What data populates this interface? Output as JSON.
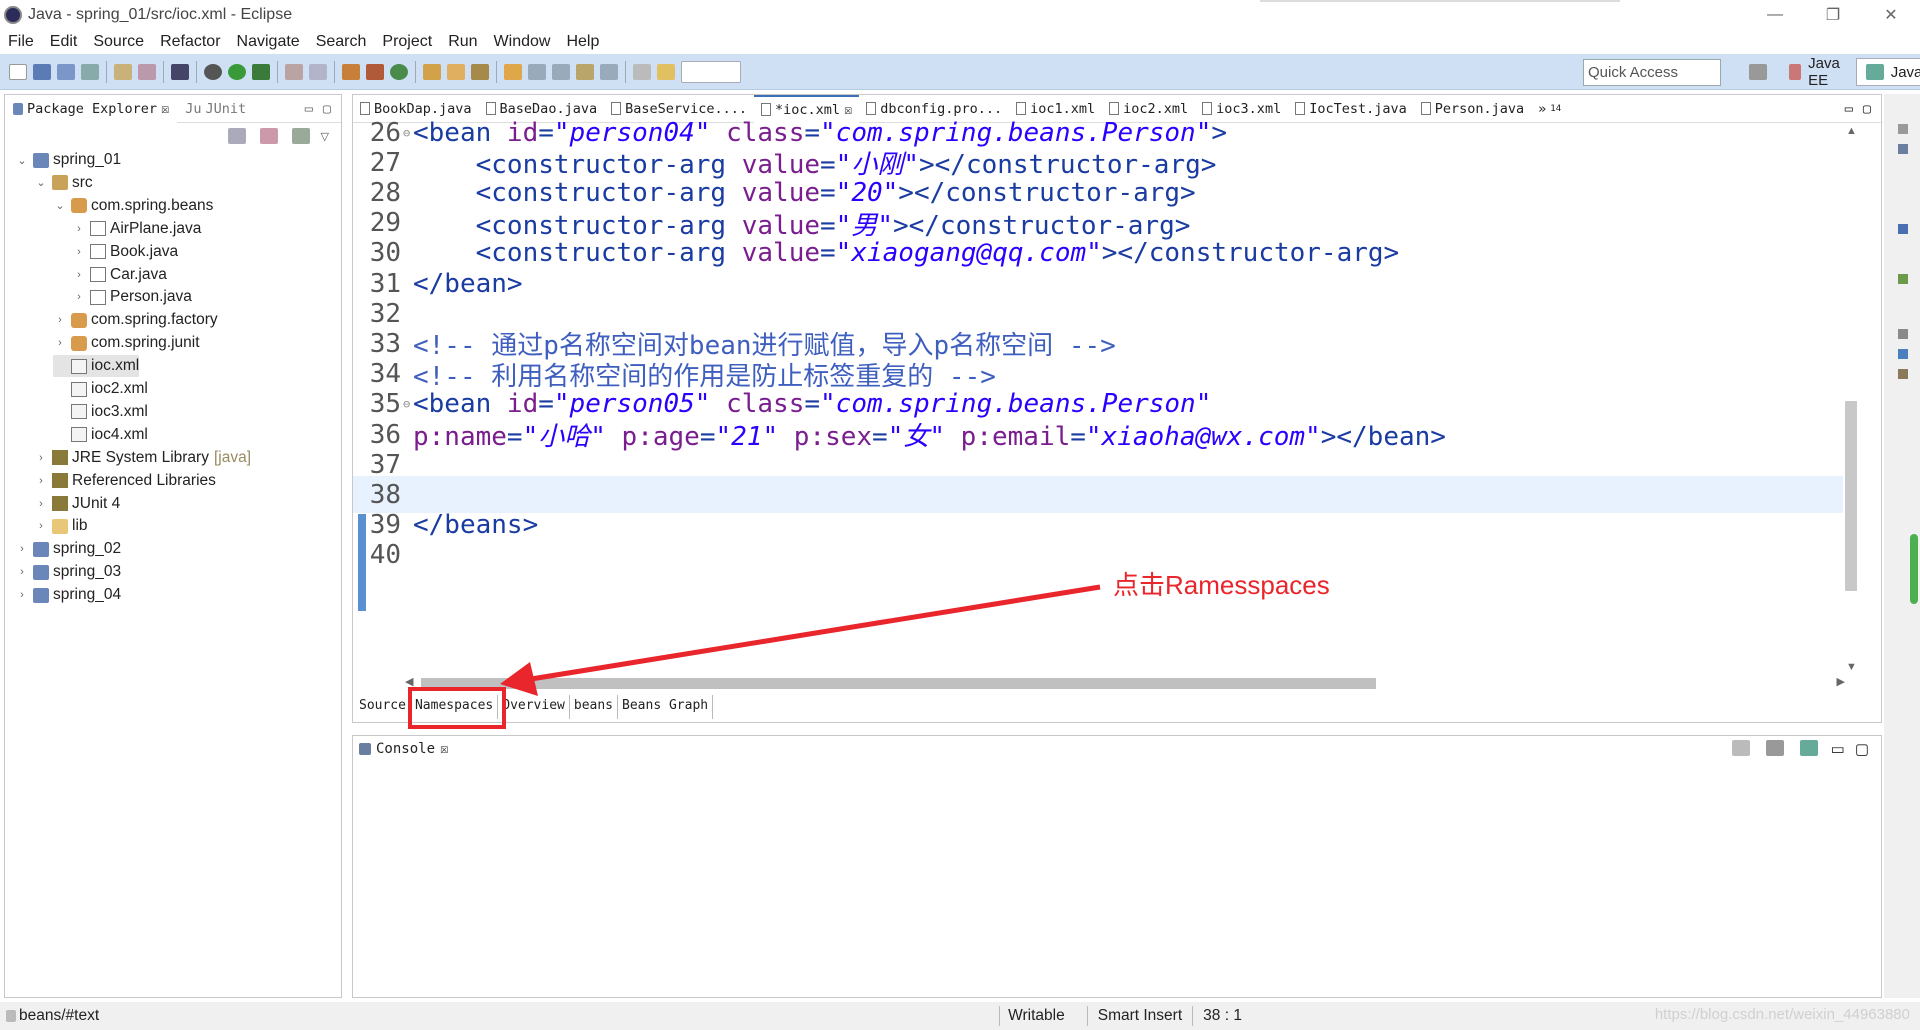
{
  "window": {
    "title": "Java - spring_01/src/ioc.xml - Eclipse"
  },
  "menu": [
    "File",
    "Edit",
    "Source",
    "Refactor",
    "Navigate",
    "Search",
    "Project",
    "Run",
    "Window",
    "Help"
  ],
  "toolbar": {
    "quick_access_placeholder": "Quick Access"
  },
  "perspectives": [
    "Java EE",
    "Java"
  ],
  "package_explorer": {
    "tabs": [
      "Package Explorer",
      "JUnit"
    ],
    "tree": [
      {
        "label": "spring_01",
        "depth": 0,
        "icon": "project",
        "expanded": true
      },
      {
        "label": "src",
        "depth": 1,
        "icon": "source-folder",
        "expanded": true
      },
      {
        "label": "com.spring.beans",
        "depth": 2,
        "icon": "package",
        "expanded": true
      },
      {
        "label": "AirPlane.java",
        "depth": 3,
        "icon": "java-file"
      },
      {
        "label": "Book.java",
        "depth": 3,
        "icon": "java-file"
      },
      {
        "label": "Car.java",
        "depth": 3,
        "icon": "java-file"
      },
      {
        "label": "Person.java",
        "depth": 3,
        "icon": "java-file"
      },
      {
        "label": "com.spring.factory",
        "depth": 2,
        "icon": "package"
      },
      {
        "label": "com.spring.junit",
        "depth": 2,
        "icon": "package"
      },
      {
        "label": "ioc.xml",
        "depth": 2,
        "icon": "xml-file",
        "selected": true
      },
      {
        "label": "ioc2.xml",
        "depth": 2,
        "icon": "xml-file"
      },
      {
        "label": "ioc3.xml",
        "depth": 2,
        "icon": "xml-file"
      },
      {
        "label": "ioc4.xml",
        "depth": 2,
        "icon": "xml-file"
      },
      {
        "label": "JRE System Library",
        "suffix": "[java]",
        "depth": 1,
        "icon": "library"
      },
      {
        "label": "Referenced Libraries",
        "depth": 1,
        "icon": "library"
      },
      {
        "label": "JUnit 4",
        "depth": 1,
        "icon": "library"
      },
      {
        "label": "lib",
        "depth": 1,
        "icon": "folder"
      },
      {
        "label": "spring_02",
        "depth": 0,
        "icon": "project"
      },
      {
        "label": "spring_03",
        "depth": 0,
        "icon": "project"
      },
      {
        "label": "spring_04",
        "depth": 0,
        "icon": "project"
      }
    ]
  },
  "editor": {
    "tabs": [
      "BookDap.java",
      "BaseDao.java",
      "BaseService....",
      "*ioc.xml",
      "dbconfig.pro...",
      "ioc1.xml",
      "ioc2.xml",
      "ioc3.xml",
      "IocTest.java",
      "Person.java"
    ],
    "overflow_count": "14",
    "active_tab": "*ioc.xml",
    "lines": [
      {
        "n": "26",
        "fold": "⊖",
        "parts": [
          [
            "tag",
            "<bean "
          ],
          [
            "attr",
            "id"
          ],
          [
            "tag",
            "="
          ],
          [
            "val",
            "\"person04\""
          ],
          [
            "tag",
            " "
          ],
          [
            "attr",
            "class"
          ],
          [
            "tag",
            "="
          ],
          [
            "val",
            "\"com.spring.beans.Person\""
          ],
          [
            "tag",
            ">"
          ]
        ]
      },
      {
        "n": "27",
        "parts": [
          [
            "tag",
            "    <constructor-arg "
          ],
          [
            "attr",
            "value"
          ],
          [
            "tag",
            "="
          ],
          [
            "val",
            "\"小刚\""
          ],
          [
            "tag",
            "></constructor-arg>"
          ]
        ]
      },
      {
        "n": "28",
        "parts": [
          [
            "tag",
            "    <constructor-arg "
          ],
          [
            "attr",
            "value"
          ],
          [
            "tag",
            "="
          ],
          [
            "val",
            "\"20\""
          ],
          [
            "tag",
            "></constructor-arg>"
          ]
        ]
      },
      {
        "n": "29",
        "parts": [
          [
            "tag",
            "    <constructor-arg "
          ],
          [
            "attr",
            "value"
          ],
          [
            "tag",
            "="
          ],
          [
            "val",
            "\"男\""
          ],
          [
            "tag",
            "></constructor-arg>"
          ]
        ]
      },
      {
        "n": "30",
        "parts": [
          [
            "tag",
            "    <constructor-arg "
          ],
          [
            "attr",
            "value"
          ],
          [
            "tag",
            "="
          ],
          [
            "val",
            "\"xiaogang@qq.com\""
          ],
          [
            "tag",
            "></constructor-arg>"
          ]
        ]
      },
      {
        "n": "31",
        "parts": [
          [
            "tag",
            "</bean>"
          ]
        ]
      },
      {
        "n": "32",
        "parts": []
      },
      {
        "n": "33",
        "parts": [
          [
            "cmt",
            "<!-- 通过p名称空间对bean进行赋值，导入p名称空间 -->"
          ]
        ]
      },
      {
        "n": "34",
        "parts": [
          [
            "cmt",
            "<!-- 利用名称空间的作用是防止标签重复的 -->"
          ]
        ]
      },
      {
        "n": "35",
        "fold": "⊖",
        "parts": [
          [
            "tag",
            "<bean "
          ],
          [
            "attr",
            "id"
          ],
          [
            "tag",
            "="
          ],
          [
            "val",
            "\"person05\""
          ],
          [
            "tag",
            " "
          ],
          [
            "attr",
            "class"
          ],
          [
            "tag",
            "="
          ],
          [
            "val",
            "\"com.spring.beans.Person\""
          ]
        ]
      },
      {
        "n": "36",
        "parts": [
          [
            "attr",
            "p:name"
          ],
          [
            "tag",
            "="
          ],
          [
            "val",
            "\"小哈\""
          ],
          [
            "tag",
            " "
          ],
          [
            "attr",
            "p:age"
          ],
          [
            "tag",
            "="
          ],
          [
            "val",
            "\"21\""
          ],
          [
            "tag",
            " "
          ],
          [
            "attr",
            "p:sex"
          ],
          [
            "tag",
            "="
          ],
          [
            "val",
            "\"女\""
          ],
          [
            "tag",
            " "
          ],
          [
            "attr",
            "p:email"
          ],
          [
            "tag",
            "="
          ],
          [
            "val",
            "\"xiaoha@wx.com\""
          ],
          [
            "tag",
            "></bean>"
          ]
        ]
      },
      {
        "n": "37",
        "parts": []
      },
      {
        "n": "38",
        "parts": [],
        "current": true
      },
      {
        "n": "39",
        "parts": [
          [
            "tag",
            "</beans>"
          ]
        ]
      },
      {
        "n": "40",
        "parts": []
      }
    ],
    "bottom_tabs": [
      "Source",
      "Namespaces",
      "Overview",
      "beans",
      "Beans Graph"
    ],
    "active_bottom_tab": "Namespaces"
  },
  "annotation": {
    "text": "点击Ramesspaces",
    "color": "#e8262c"
  },
  "console": {
    "tab": "Console"
  },
  "status": {
    "path": "beans/#text",
    "mode": "Writable",
    "insert": "Smart Insert",
    "position": "38 : 1"
  },
  "watermark": "https://blog.csdn.net/weixin_44963880",
  "colors": {
    "toolbar": "#cfe0f5",
    "annotation": "#e8262c",
    "tag": "#1a3ba1",
    "attr": "#7a1e8f",
    "value": "#2a00ff",
    "comment": "#3f5fbf"
  }
}
